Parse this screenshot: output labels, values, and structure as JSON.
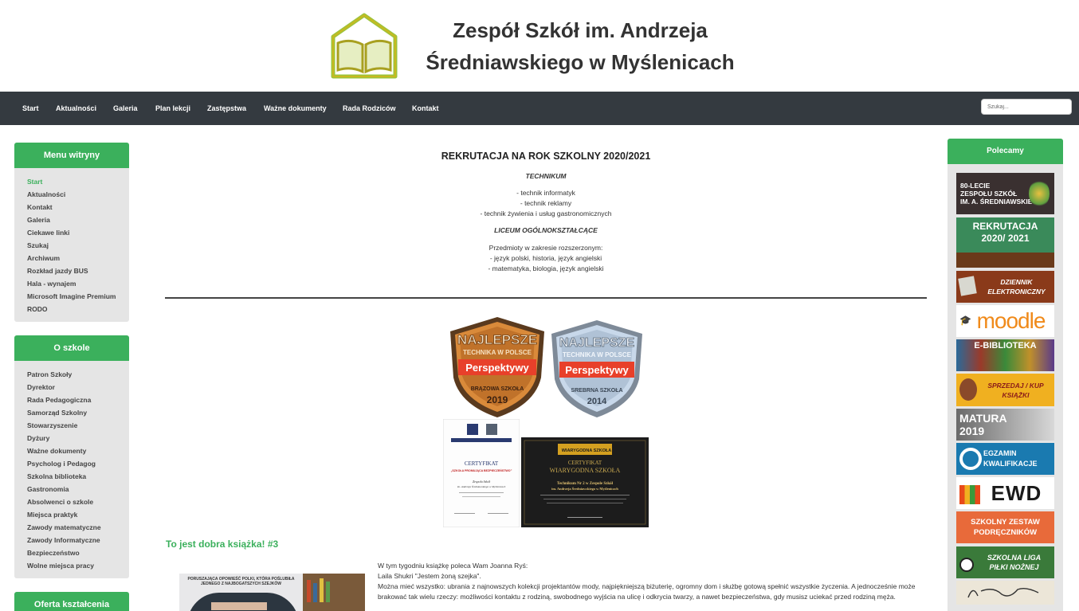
{
  "header": {
    "title_line1": "Zespół Szkół im. Andrzeja",
    "title_line2": "Średniawskiego w Myślenicach"
  },
  "nav": {
    "items": [
      "Start",
      "Aktualności",
      "Galeria",
      "Plan lekcji",
      "Zastępstwa",
      "Ważne dokumenty",
      "Rada Rodziców",
      "Kontakt"
    ],
    "search_placeholder": "Szukaj..."
  },
  "sidebar": {
    "menu": {
      "title": "Menu witryny",
      "items": [
        "Start",
        "Aktualności",
        "Kontakt",
        "Galeria",
        "Ciekawe linki",
        "Szukaj",
        "Archiwum",
        "Rozkład jazdy BUS",
        "Hala - wynajem",
        "Microsoft Imagine Premium",
        "RODO"
      ]
    },
    "about": {
      "title": "O szkole",
      "items": [
        "Patron Szkoły",
        "Dyrektor",
        "Rada Pedagogiczna",
        "Samorząd Szkolny",
        "Stowarzyszenie",
        "Dyżury",
        "Ważne dokumenty",
        "Psycholog i Pedagog",
        "Szkolna biblioteka",
        "Gastronomia",
        "Absolwenci o szkole",
        "Miejsca praktyk",
        "Zawody matematyczne",
        "Zawody Informatyczne",
        "Bezpieczeństwo",
        "Wolne miejsca pracy"
      ]
    },
    "offer": {
      "title": "Oferta kształcenia"
    }
  },
  "recommend": {
    "title": "Polecamy",
    "banners": {
      "b80": [
        "80-LECIE",
        "ZESPOŁU SZKÓŁ",
        "IM. A. ŚREDNIAWSKIEGO"
      ],
      "rekrutacja": [
        "REKRUTACJA",
        "2020/ 2021"
      ],
      "dziennik": [
        "DZIENNIK",
        "ELEKTRONICZNY"
      ],
      "moodle": "moodle",
      "ebiblioteka": "E-BIBLIOTEKA",
      "sprzedaj": [
        "SPRZEDAJ / KUP",
        "KSIĄŻKI"
      ],
      "matura": [
        "MATURA",
        "2019"
      ],
      "egzamin": [
        "EGZAMIN",
        "KWALIFIKACJE"
      ],
      "ewd": "EWD",
      "zestaw": [
        "SZKOLNY ZESTAW",
        "PODRĘCZNIKÓW"
      ],
      "liga": [
        "SZKOLNA LIGA",
        "PIŁKI NOŻNEJ"
      ]
    }
  },
  "main": {
    "recruitment_title": "REKRUTACJA NA ROK SZKOLNY 2020/2021",
    "technikum_label": "TECHNIKUM",
    "technikum_items": [
      "- technik informatyk",
      "- technik reklamy",
      "- technik żywienia i usług gastronomicznych"
    ],
    "liceum_label": "LICEUM OGÓLNOKSZTAŁCĄCE",
    "liceum_intro": "Przedmioty w zakresie rozszerzonym:",
    "liceum_items": [
      "- język polski, historia, język angielski",
      "- matematyka, biologia, język angielski"
    ],
    "badge1": {
      "top": "NAJLEPSZE",
      "sub": "TECHNIKA W POLSCE",
      "brand": "Perspektywy",
      "rank": "BRĄZOWA SZKOŁA",
      "year": "2019"
    },
    "badge2": {
      "top": "NAJLEPSZE",
      "sub": "TECHNIKA W POLSCE",
      "brand": "Perspektywy",
      "rank": "SREBRNA SZKOŁA",
      "year": "2014"
    },
    "cert1": {
      "title": "CERTYFIKAT",
      "subtitle": "„SZKOŁA PROMUJĄCA BEZPIECZEŃSTWO”",
      "school": "Zespołu Szkół",
      "school2": "im. Andrzeja Średniawskiego w Myślenicach"
    },
    "cert2": {
      "logo": "WIARYGODNA SZKOŁA",
      "title": "CERTYFIKAT",
      "subtitle": "WIARYGODNA SZKOŁA",
      "school": "Technikum Nr 2 w Zespole Szkół",
      "school2": "im. Andrzeja Średniawskiego w Myślenicach"
    },
    "post": {
      "title": "To jest dobra książka! #3",
      "lines": [
        "W tym tygodniu książkę poleca Wam Joanna Ryś:",
        "Laila Shukri \"Jestem żoną szejka\".",
        "Można mieć wszystko: ubrania z najnowszych kolekcji projektantów mody, najpiękniejszą biżuterię, ogromny dom i służbę gotową spełnić wszystkie życzenia. A jednocześnie może brakować tak wielu rzeczy: możliwości kontaktu z rodziną, swobodnego wyjścia na ulicę i odkrycia twarzy, a nawet bezpieczeństwa, gdy musisz uciekać przed rodziną męża."
      ],
      "book_cover_text": "PORUSZAJĄCA OPOWIEŚĆ POLKI, KTÓRA POŚLUBIŁA JEDNEGO Z NAJBOGATSZYCH SZEJKÓW"
    }
  },
  "colors": {
    "accent": "#3bb05c",
    "nav_bg": "#343a40",
    "panel_bg": "#e5e5e5"
  }
}
